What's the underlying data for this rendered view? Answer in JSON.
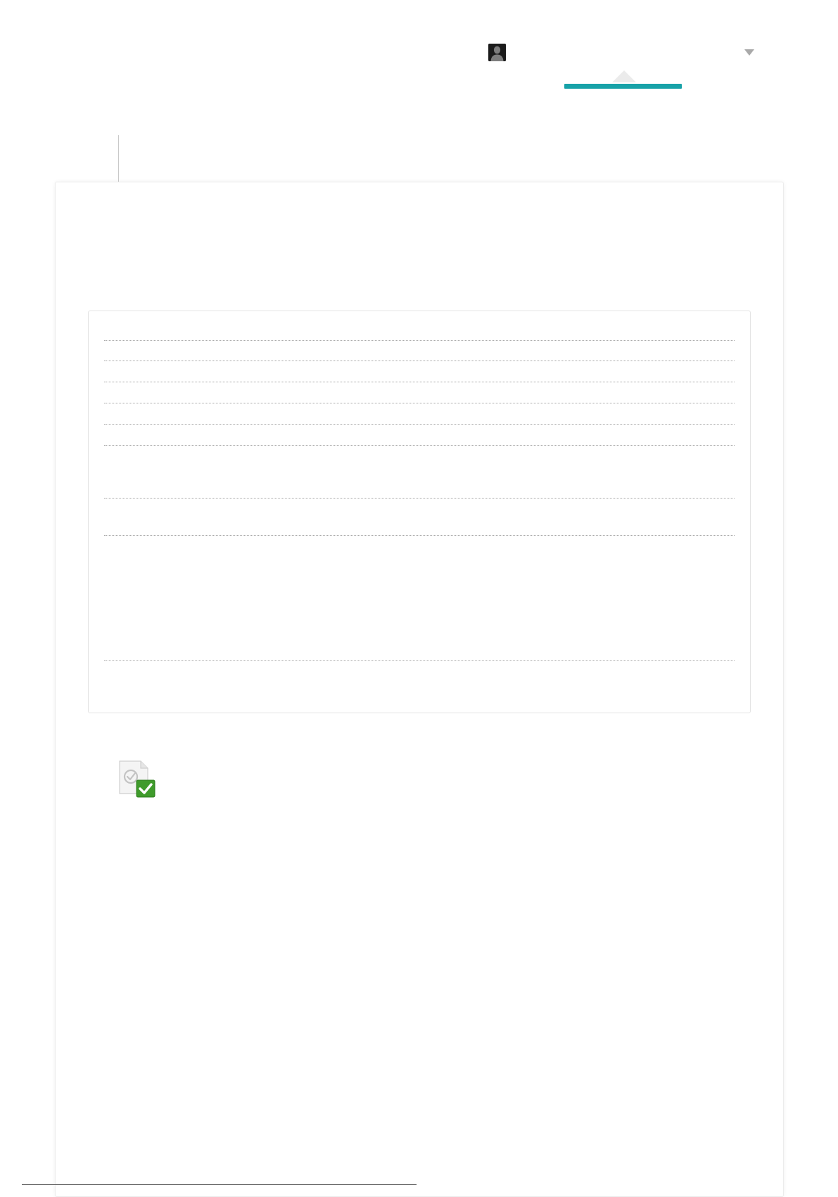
{
  "header": {
    "user_menu": {
      "avatar_icon": "user-silhouette-icon",
      "username": "",
      "dropdown_icon": "triangle-down-icon"
    },
    "active_tab": {
      "label": "",
      "accent_color": "#17a2a8"
    }
  },
  "main": {
    "title": "",
    "details": {
      "rows": [
        {
          "label": "",
          "value": ""
        },
        {
          "label": "",
          "value": ""
        },
        {
          "label": "",
          "value": ""
        },
        {
          "label": "",
          "value": ""
        },
        {
          "label": "",
          "value": ""
        },
        {
          "label": "",
          "value": ""
        },
        {
          "label": "",
          "value": ""
        },
        {
          "label": "",
          "value": ""
        },
        {
          "label": "",
          "value": ""
        }
      ]
    },
    "status": {
      "icon": "document-check-icon",
      "text": ""
    }
  },
  "footer": {
    "mark": ""
  }
}
